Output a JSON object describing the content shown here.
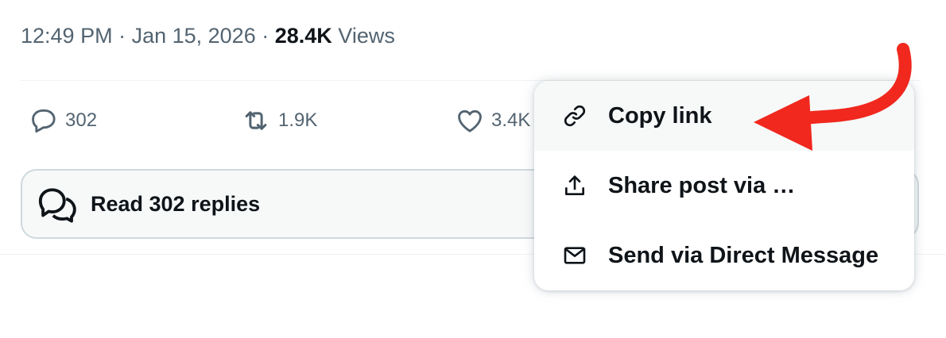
{
  "post_meta": {
    "time": "12:49 PM",
    "separator": " · ",
    "date": "Jan 15, 2026",
    "views_count": "28.4K",
    "views_label": "Views"
  },
  "actions": {
    "reply": {
      "icon": "reply-icon",
      "count": "302"
    },
    "repost": {
      "icon": "repost-icon",
      "count": "1.9K"
    },
    "like": {
      "icon": "heart-icon",
      "count": "3.4K"
    }
  },
  "read_replies": {
    "icon": "conversation-icon",
    "label": "Read 302 replies"
  },
  "share_menu": {
    "items": [
      {
        "icon": "link-icon",
        "label": "Copy link",
        "highlighted": true
      },
      {
        "icon": "upload-share-icon",
        "label": "Share post via …"
      },
      {
        "icon": "envelope-icon",
        "label": "Send via Direct Message"
      }
    ]
  },
  "colors": {
    "text_primary": "#0f1419",
    "text_secondary": "#536471",
    "border": "#cfd9de",
    "hover_background": "#f7f9f9",
    "annotation_arrow": "#f0281e"
  }
}
